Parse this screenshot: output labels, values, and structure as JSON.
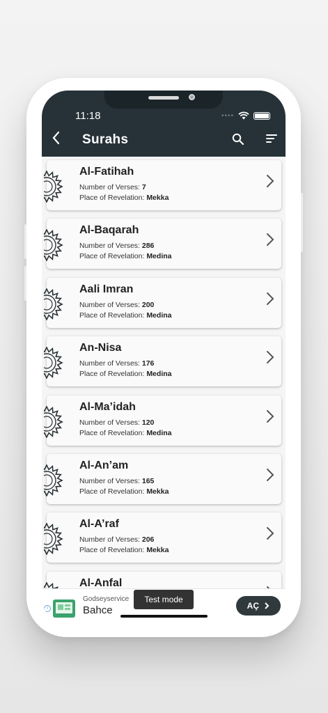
{
  "status_bar": {
    "time": "11:18"
  },
  "header": {
    "title": "Surahs",
    "back_icon": "chevron-left-icon",
    "search_icon": "search-icon",
    "filter_icon": "sort-icon"
  },
  "labels": {
    "verses": "Number of Verses:",
    "revelation": "Place of Revelation:"
  },
  "surahs": [
    {
      "name": "Al-Fatihah",
      "verses": "7",
      "place": "Mekka"
    },
    {
      "name": "Al-Baqarah",
      "verses": "286",
      "place": "Medina"
    },
    {
      "name": "Aali Imran",
      "verses": "200",
      "place": "Medina"
    },
    {
      "name": "An-Nisa",
      "verses": "176",
      "place": "Medina"
    },
    {
      "name": "Al-Ma’idah",
      "verses": "120",
      "place": "Medina"
    },
    {
      "name": "Al-An’am",
      "verses": "165",
      "place": "Mekka"
    },
    {
      "name": "Al-A’raf",
      "verses": "206",
      "place": "Mekka"
    },
    {
      "name": "Al-Anfal",
      "verses": "",
      "place": ""
    }
  ],
  "ad": {
    "sponsor": "Godseyservice",
    "title": "Bahce",
    "test_mode": "Test mode",
    "cta": "AÇ",
    "info": "i"
  },
  "colors": {
    "header": "#263238",
    "card": "#fafafa",
    "background": "#f5f5f5"
  }
}
